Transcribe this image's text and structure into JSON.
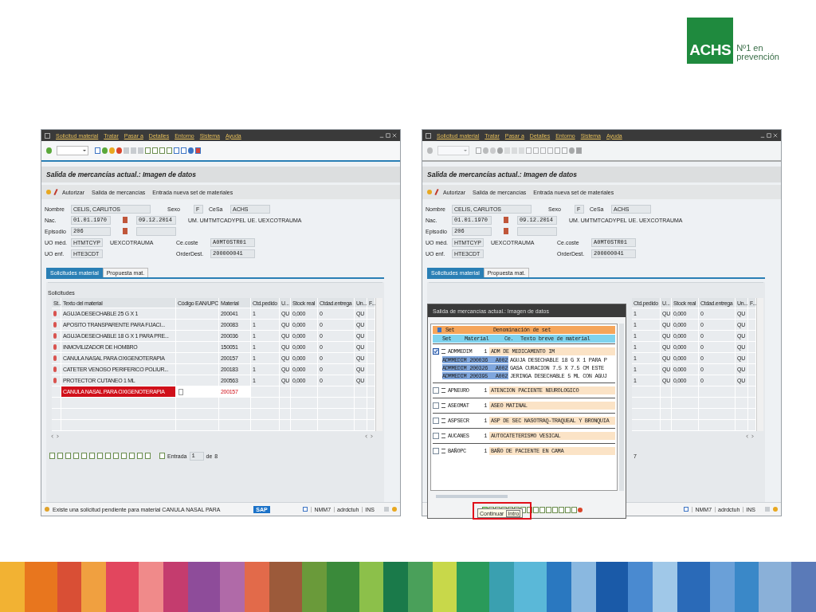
{
  "logo": {
    "mark": "ACHS",
    "line_1": "Nº1 en",
    "line_2": "prevención"
  },
  "windows": [
    {
      "menu": [
        "Solicitud material",
        "Tratar",
        "Pasar a",
        "Detalles",
        "Entorno",
        "Sistema",
        "Ayuda"
      ],
      "toolbar_disabled": false,
      "title": "Salida de mercancías actual.: Imagen de datos",
      "actions": [
        "Autorizar",
        "Salida de mercancías",
        "Entrada nueva set de materiales"
      ],
      "form": {
        "nombre_label": "Nombre",
        "nombre": "CELIS, CARLITOS",
        "sexo_label": "Sexo",
        "sexo": "F",
        "cesa_label": "CeSa",
        "cesa": "ACHS",
        "nac_label": "Nac.",
        "nac": "01.01.1970",
        "date": "09.12.2014",
        "um_ue": "UM. UMTMTCADYPEL  UE. UEXCOTRAUMA",
        "episodio_label": "Episodio",
        "episodio": "206",
        "uo_med_label": "UO méd.",
        "uo_med": "HTMTCYP",
        "uo_med_desc": "UEXCOTRAUMA",
        "cecoste_label": "Ce.coste",
        "cecoste": "A0MT0STR01",
        "uo_enf_label": "UO enf.",
        "uo_enf": "HTE3CDT",
        "orderdest_label": "OrderDest.",
        "orderdest": "200000041"
      },
      "tabs": [
        {
          "label": "Solicitudes material",
          "selected": true
        },
        {
          "label": "Propuesta mat.",
          "selected": false
        }
      ],
      "section": "Solicitudes",
      "table": {
        "columns": [
          {
            "label": "St..."
          },
          {
            "label": "Texto del material"
          },
          {
            "label": "Código EAN/UPC"
          },
          {
            "label": "Material"
          },
          {
            "label": "Ctd.pedido"
          },
          {
            "label": "U..."
          },
          {
            "label": "Stock real"
          },
          {
            "label": "Ctdad.entrega"
          },
          {
            "label": "Un..."
          },
          {
            "label": "F..."
          }
        ],
        "rows": [
          {
            "kind": "item",
            "text": "AGUJA DESECHABLE 25 G X 1",
            "material": "200041",
            "qty": "1",
            "unit": "QU",
            "stock": "0,000",
            "delivered": "0",
            "unit2": "QU"
          },
          {
            "kind": "item",
            "text": "APOSITO TRANSPARENTE PARA FIJACI...",
            "material": "200083",
            "qty": "1",
            "unit": "QU",
            "stock": "0,000",
            "delivered": "0",
            "unit2": "QU"
          },
          {
            "kind": "item",
            "text": "AGUJA DESECHABLE 18 G X 1 PARA PRE...",
            "material": "200036",
            "qty": "1",
            "unit": "QU",
            "stock": "0,000",
            "delivered": "0",
            "unit2": "QU"
          },
          {
            "kind": "item",
            "text": "INMOVILIZADOR DE HOMBRO",
            "material": "150051",
            "qty": "1",
            "unit": "QU",
            "stock": "0,000",
            "delivered": "0",
            "unit2": "QU"
          },
          {
            "kind": "item",
            "text": "CANULA NASAL PARA OXIGENOTERAPIA",
            "material": "200157",
            "qty": "1",
            "unit": "QU",
            "stock": "0,000",
            "delivered": "0",
            "unit2": "QU"
          },
          {
            "kind": "item",
            "text": "CATETER VENOSO PERIFERICO POLIUR...",
            "material": "200183",
            "qty": "1",
            "unit": "QU",
            "stock": "0,000",
            "delivered": "0",
            "unit2": "QU"
          },
          {
            "kind": "item",
            "text": "PROTECTOR CUTANEO 1 ML",
            "material": "200563",
            "qty": "1",
            "unit": "QU",
            "stock": "0,000",
            "delivered": "0",
            "unit2": "QU"
          },
          {
            "kind": "edit",
            "text": "CANULA NASAL PARA OXIGENOTERAPIA",
            "material": "200157"
          }
        ]
      },
      "footer": {
        "label": "Entrada",
        "value": "1",
        "of": "de",
        "total": "8"
      },
      "status": {
        "message": "Existe una solicitud pendiente para material CANULA NASAL PARA",
        "logo": "SAP",
        "system": "NMM7",
        "user": "adrdctuh",
        "mode": "INS"
      }
    },
    {
      "menu": [
        "Solicitud material",
        "Tratar",
        "Pasar a",
        "Detalles",
        "Entorno",
        "Sistema",
        "Ayuda"
      ],
      "toolbar_disabled": true,
      "title": "Salida de mercancías actual.: Imagen de datos",
      "actions": [
        "Autorizar",
        "Salida de mercancías",
        "Entrada nueva set de materiales"
      ],
      "form": {
        "nombre_label": "Nombre",
        "nombre": "CELIS, CARLITOS",
        "sexo_label": "Sexo",
        "sexo": "F",
        "cesa_label": "CeSa",
        "cesa": "ACHS",
        "nac_label": "Nac.",
        "nac": "01.01.1970",
        "date": "09.12.2014",
        "um_ue": "UM. UMTMTCADYPEL  UE. UEXCOTRAUMA",
        "episodio_label": "Episodio",
        "episodio": "206",
        "uo_med_label": "UO méd.",
        "uo_med": "HTMTCYP",
        "uo_med_desc": "UEXCOTRAUMA",
        "cecoste_label": "Ce.coste",
        "cecoste": "A0MT0STR01",
        "uo_enf_label": "UO enf.",
        "uo_enf": "HTE3CDT",
        "orderdest_label": "OrderDest.",
        "orderdest": "200000041"
      },
      "tabs": [
        {
          "label": "Solicitudes material",
          "selected": true
        },
        {
          "label": "Propuesta mat.",
          "selected": false
        }
      ],
      "table": {
        "columns": [
          {
            "label": "Ctd.pedido"
          },
          {
            "label": "U..."
          },
          {
            "label": "Stock real"
          },
          {
            "label": "Ctdad.entrega"
          },
          {
            "label": "Un..."
          },
          {
            "label": "F..."
          }
        ],
        "rows": [
          {
            "kind": "item",
            "qty": "1",
            "unit": "QU",
            "stock": "0,000",
            "delivered": "0",
            "unit2": "QU"
          },
          {
            "kind": "item",
            "qty": "1",
            "unit": "QU",
            "stock": "0,000",
            "delivered": "0",
            "unit2": "QU"
          },
          {
            "kind": "item",
            "qty": "1",
            "unit": "QU",
            "stock": "0,000",
            "delivered": "0",
            "unit2": "QU"
          },
          {
            "kind": "item",
            "qty": "1",
            "unit": "QU",
            "stock": "0,000",
            "delivered": "0",
            "unit2": "QU"
          },
          {
            "kind": "item",
            "qty": "1",
            "unit": "QU",
            "stock": "0,000",
            "delivered": "0",
            "unit2": "QU"
          },
          {
            "kind": "item",
            "qty": "1",
            "unit": "QU",
            "stock": "0,000",
            "delivered": "0",
            "unit2": "QU"
          },
          {
            "kind": "item",
            "qty": "1",
            "unit": "QU",
            "stock": "0,000",
            "delivered": "0",
            "unit2": "QU"
          }
        ]
      },
      "footer": {
        "total": "7"
      },
      "status": {
        "system": "NMM7",
        "user": "adrdctuh",
        "mode": "INS"
      },
      "popup": {
        "title": "Salida de mercancías actual.: Imagen de datos",
        "header": {
          "set": "Set",
          "denominacion": "Denominación de set",
          "set2": "Set",
          "material": "Material",
          "ce": "Ce.",
          "texto": "Texto breve de material"
        },
        "sets": [
          {
            "code": "ADMMEDIM",
            "qty": "1",
            "name": "ADM DE MEDICAMENTO IM",
            "checked": true,
            "children": [
              {
                "set": "ADMMEDIM",
                "material": "200036",
                "ce": "A002",
                "text": "AGUJA DESECHABLE 18 G X 1 PARA P"
              },
              {
                "set": "ADMMEDIM",
                "material": "200326",
                "ce": "A002",
                "text": "GASA CURACION 7.5 X 7.5 CM ESTE"
              },
              {
                "set": "ADMMEDIM",
                "material": "200395",
                "ce": "A002",
                "text": "JERINGA DESECHABLE 5 ML CON AGUJ"
              }
            ]
          },
          {
            "code": "APNEURO",
            "qty": "1",
            "name": "ATENCION PACIENTE NEUROLOGICO",
            "checked": false
          },
          {
            "code": "ASEOMAT",
            "qty": "1",
            "name": "ASEO MATINAL",
            "checked": false
          },
          {
            "code": "ASPSECR",
            "qty": "1",
            "name": "ASP DE SEC NASOTRAQ-TRAQUEAL Y BRONQUIA",
            "checked": false
          },
          {
            "code": "AUCANES",
            "qty": "1",
            "name": "AUTOCATETERISMO VESICAL",
            "checked": false
          },
          {
            "code": "BAÑOPC",
            "qty": "1",
            "name": "BAÑO DE PACIENTE EN CAMA",
            "checked": false
          }
        ],
        "tooltip_label": "Continuar",
        "tooltip_key": "Intro"
      }
    }
  ]
}
